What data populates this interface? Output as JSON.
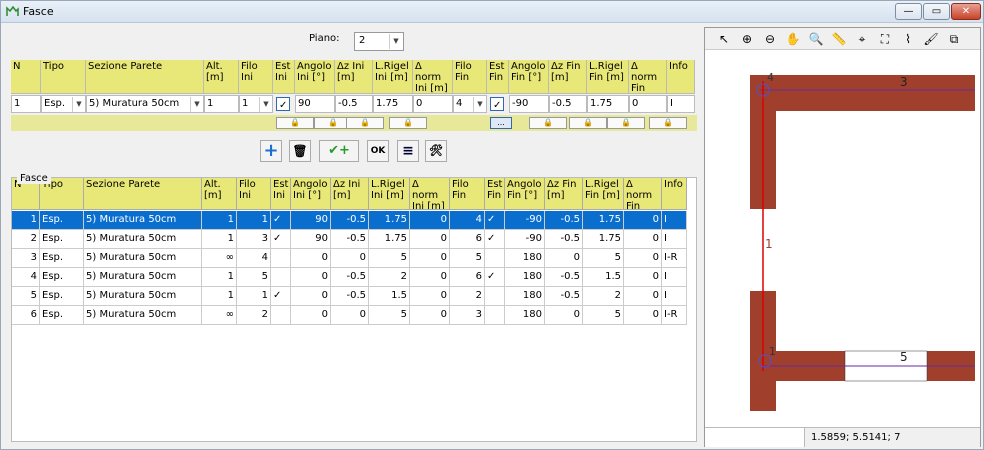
{
  "window": {
    "title": "Fasce",
    "min": "—",
    "restore": "▭",
    "close": "✕"
  },
  "piano": {
    "label": "Piano:",
    "value": "2"
  },
  "headers": [
    "N",
    "Tipo",
    "Sezione Parete",
    "Alt. [m]",
    "Filo Ini",
    "Est Ini",
    "Angolo Ini [°]",
    "Δz Ini [m]",
    "L.Rigel Ini [m]",
    "Δ norm Ini [m]",
    "Filo Fin",
    "Est Fin",
    "Angolo Fin [°]",
    "Δz Fin [m]",
    "L.Rigel Fin [m]",
    "Δ norm Fin [m]",
    "Info"
  ],
  "edit": {
    "n": "1",
    "tipo": "Esp.",
    "sezione": "5) Muratura 50cm",
    "alt": "1",
    "filo_ini": "1",
    "angolo_ini": "90",
    "dz_ini": "-0.5",
    "lrigel_ini": "1.75",
    "dnorm_ini": "0",
    "filo_fin": "4",
    "angolo_fin": "-90",
    "dz_fin": "-0.5",
    "lrigel_fin": "1.75",
    "dnorm_fin": "0",
    "info": "I",
    "ellipsis": "..."
  },
  "actions": {
    "add": "+",
    "delete": "🗑",
    "confirm_add": "✔+",
    "ok": "OK",
    "lines": "≡",
    "tools": "🛠"
  },
  "group_label": "Fasce",
  "rows": [
    {
      "n": "1",
      "tipo": "Esp.",
      "sez": "5) Muratura 50cm",
      "alt": "1",
      "fi": "1",
      "ei": "✓",
      "ai": "90",
      "dzi": "-0.5",
      "lri": "1.75",
      "dni": "0",
      "ff": "4",
      "ef": "✓",
      "af": "-90",
      "dzf": "-0.5",
      "lrf": "1.75",
      "dnf": "0",
      "info": "I"
    },
    {
      "n": "2",
      "tipo": "Esp.",
      "sez": "5) Muratura 50cm",
      "alt": "1",
      "fi": "3",
      "ei": "✓",
      "ai": "90",
      "dzi": "-0.5",
      "lri": "1.75",
      "dni": "0",
      "ff": "6",
      "ef": "✓",
      "af": "-90",
      "dzf": "-0.5",
      "lrf": "1.75",
      "dnf": "0",
      "info": "I"
    },
    {
      "n": "3",
      "tipo": "Esp.",
      "sez": "5) Muratura 50cm",
      "alt": "∞",
      "fi": "4",
      "ei": "",
      "ai": "0",
      "dzi": "0",
      "lri": "5",
      "dni": "0",
      "ff": "5",
      "ef": "",
      "af": "180",
      "dzf": "0",
      "lrf": "5",
      "dnf": "0",
      "info": "I-R"
    },
    {
      "n": "4",
      "tipo": "Esp.",
      "sez": "5) Muratura 50cm",
      "alt": "1",
      "fi": "5",
      "ei": "",
      "ai": "0",
      "dzi": "-0.5",
      "lri": "2",
      "dni": "0",
      "ff": "6",
      "ef": "✓",
      "af": "180",
      "dzf": "-0.5",
      "lrf": "1.5",
      "dnf": "0",
      "info": "I"
    },
    {
      "n": "5",
      "tipo": "Esp.",
      "sez": "5) Muratura 50cm",
      "alt": "1",
      "fi": "1",
      "ei": "✓",
      "ai": "0",
      "dzi": "-0.5",
      "lri": "1.5",
      "dni": "0",
      "ff": "2",
      "ef": "",
      "af": "180",
      "dzf": "-0.5",
      "lrf": "2",
      "dnf": "0",
      "info": "I"
    },
    {
      "n": "6",
      "tipo": "Esp.",
      "sez": "5) Muratura 50cm",
      "alt": "∞",
      "fi": "2",
      "ei": "",
      "ai": "0",
      "dzi": "0",
      "lri": "5",
      "dni": "0",
      "ff": "3",
      "ef": "",
      "af": "180",
      "dzf": "0",
      "lrf": "5",
      "dnf": "0",
      "info": "I-R"
    }
  ],
  "selected_row": 0,
  "drawing": {
    "labels": [
      "4",
      "3",
      "1",
      "1",
      "5"
    ],
    "wall_color": "#a0402c"
  },
  "status": {
    "left": "",
    "coords": "1.5859; 5.5141; 7"
  },
  "tools": [
    "pointer-icon",
    "zoom-in-icon",
    "zoom-out-icon",
    "pan-icon",
    "zoom-window-icon",
    "measure-icon",
    "zoom-extents-icon",
    "fit-icon",
    "snap-icon",
    "paint-icon",
    "layers-icon"
  ]
}
